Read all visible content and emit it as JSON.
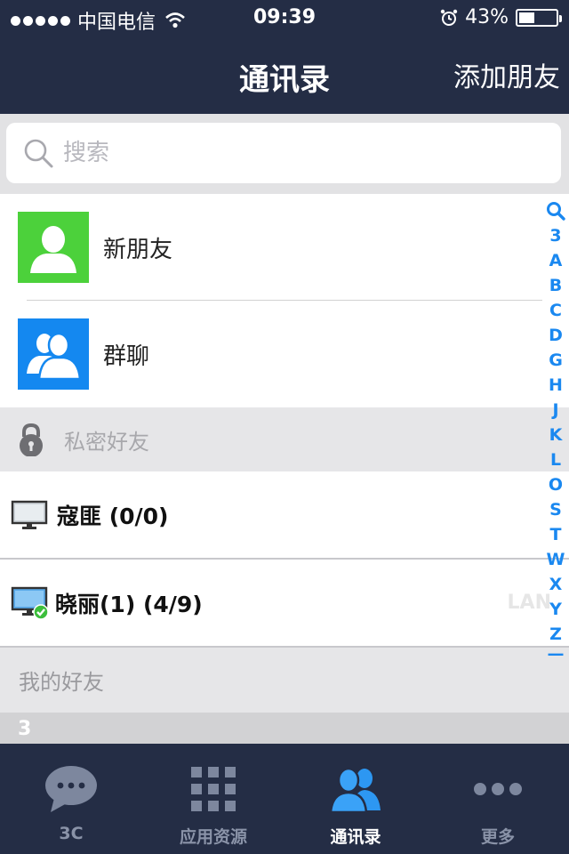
{
  "status_bar": {
    "carrier": "中国电信",
    "time": "09:39",
    "battery": "43%",
    "battery_level": 0.43
  },
  "nav": {
    "title": "通讯录",
    "add_friend": "添加朋友"
  },
  "search": {
    "placeholder": "搜索"
  },
  "entries": {
    "new_friend": "新朋友",
    "group_chat": "群聊"
  },
  "private_section": {
    "label": "私密好友"
  },
  "groups": [
    {
      "name": "寇匪 (0/0)",
      "icon": "monitor-icon"
    },
    {
      "name": "晓丽(1) (4/9)",
      "icon": "monitor-online-icon",
      "tag": "LAN"
    }
  ],
  "my_friends": {
    "label": "我的好友"
  },
  "index_header": "3",
  "index_letters": [
    "3",
    "A",
    "B",
    "C",
    "D",
    "G",
    "H",
    "J",
    "K",
    "L",
    "O",
    "S",
    "T",
    "W",
    "X",
    "Y",
    "Z",
    "—"
  ],
  "tabs": [
    {
      "label": "3C",
      "icon": "chat-bubble-icon"
    },
    {
      "label": "应用资源",
      "icon": "app-grid-icon"
    },
    {
      "label": "通讯录",
      "icon": "contacts-icon",
      "active": true
    },
    {
      "label": "更多",
      "icon": "more-dots-icon"
    }
  ],
  "colors": {
    "header_bg": "#242d45",
    "accent": "#1a88f0",
    "new_friend_green": "#4cd13b",
    "group_blue": "#1488f0"
  }
}
